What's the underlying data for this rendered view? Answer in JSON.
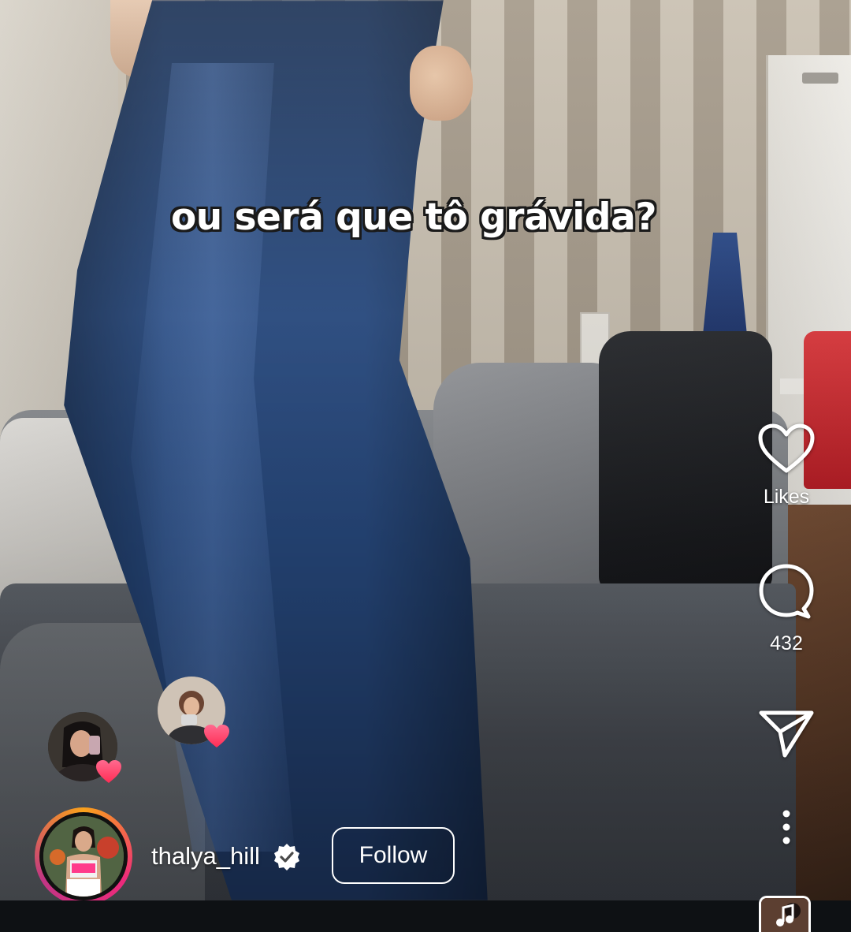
{
  "video": {
    "caption": "ou será que tô grávida?"
  },
  "actions": {
    "like_label": "Likes",
    "comment_count": "432"
  },
  "author": {
    "username": "thalya_hill",
    "verified": true,
    "follow_label": "Follow"
  },
  "icons": {
    "like": "heart-outline-icon",
    "comment": "comment-bubble-icon",
    "share": "paper-plane-icon",
    "more": "vertical-dots-icon",
    "audio": "music-note-icon",
    "verified": "verified-badge-icon"
  },
  "colors": {
    "heart_badge": "#ff3b6b",
    "story_ring": [
      "#f9a11b",
      "#ee2a7b",
      "#c13584"
    ],
    "background": "#0e1114"
  }
}
